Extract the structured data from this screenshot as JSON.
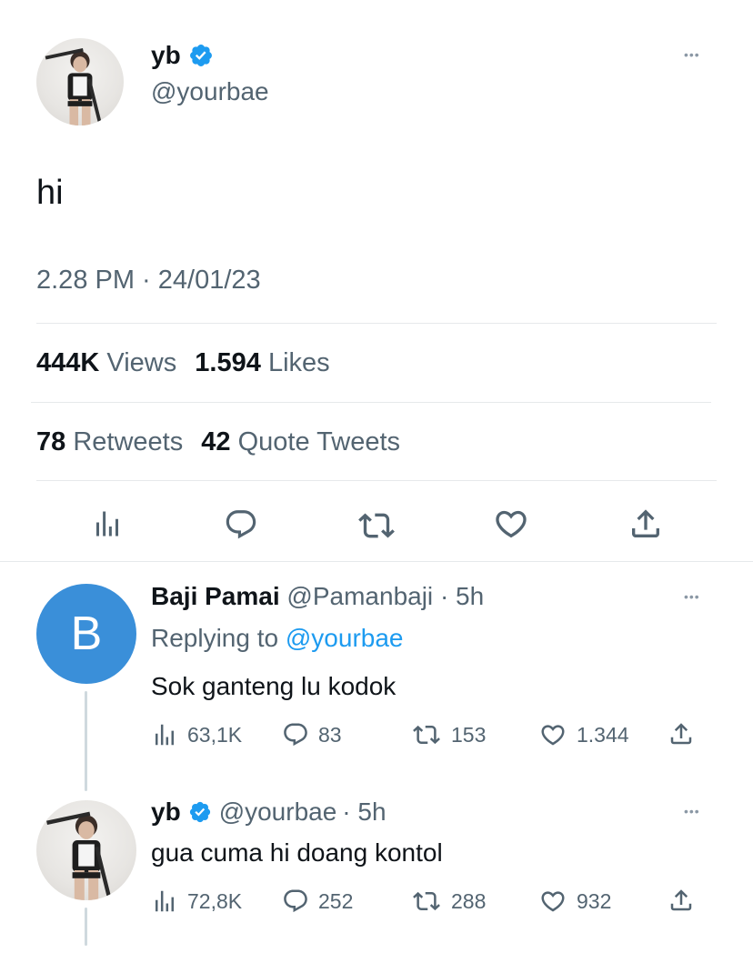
{
  "main_tweet": {
    "author_name": "yb",
    "author_handle": "@yourbae",
    "text": "hi",
    "timestamp": "2.28 PM · 24/01/23",
    "views_count": "444K",
    "views_label": "Views",
    "likes_count": "1.594",
    "likes_label": "Likes",
    "retweets_count": "78",
    "retweets_label": "Retweets",
    "quotes_count": "42",
    "quotes_label": "Quote Tweets"
  },
  "reply_1": {
    "avatar_letter": "B",
    "author_name": "Baji Pamai",
    "author_handle": "@Pamanbaji",
    "time": "· 5h",
    "replying_label": "Replying to",
    "replying_handle": "@yourbae",
    "text": "Sok ganteng lu kodok",
    "views": "63,1K",
    "replies": "83",
    "retweets": "153",
    "likes": "1.344"
  },
  "reply_2": {
    "author_name": "yb",
    "author_handle": "@yourbae",
    "time": "· 5h",
    "text": "gua cuma hi doang kontol",
    "views": "72,8K",
    "replies": "252",
    "retweets": "288",
    "likes": "932"
  },
  "more_label": "•••",
  "colors": {
    "verified": "#1d9bf0",
    "link": "#1d9bf0",
    "avatar_letter_bg": "#3a8fd9",
    "muted": "#536471",
    "icon": "#536471",
    "divider": "#e6e9eb"
  },
  "icons": [
    "verified-badge-icon",
    "more-icon",
    "analytics-icon",
    "reply-icon",
    "retweet-icon",
    "like-icon",
    "share-icon"
  ]
}
